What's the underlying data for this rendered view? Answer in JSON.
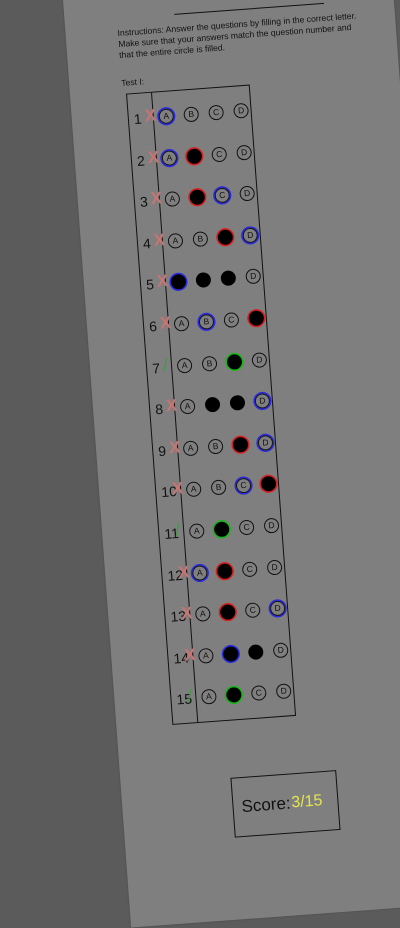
{
  "instructions": "Instructions:  Answer the questions by filling in the correct letter. Make sure that your answers match the question number and that the entire circle is filled.",
  "test_label": "Test I:",
  "choices": [
    "A",
    "B",
    "C",
    "D"
  ],
  "questions": [
    {
      "number": "1",
      "mark": "X",
      "status": "wrong",
      "filled": [],
      "key": 0,
      "key_color": "blue"
    },
    {
      "number": "2",
      "mark": "X",
      "status": "wrong",
      "filled": [
        1
      ],
      "key": 0,
      "key_color": "blue",
      "wrong_pick": 1
    },
    {
      "number": "3",
      "mark": "X",
      "status": "wrong",
      "filled": [
        1
      ],
      "key": 2,
      "key_color": "blue",
      "wrong_pick": 1
    },
    {
      "number": "4",
      "mark": "X",
      "status": "wrong",
      "filled": [
        2
      ],
      "key": 3,
      "key_color": "blue",
      "wrong_pick": 2
    },
    {
      "number": "5",
      "mark": "X",
      "status": "wrong",
      "filled": [
        0,
        1,
        2
      ],
      "key": 0,
      "key_color": "blue"
    },
    {
      "number": "6",
      "mark": "X",
      "status": "wrong",
      "filled": [
        3
      ],
      "key": 1,
      "key_color": "blue",
      "wrong_pick": 3
    },
    {
      "number": "7",
      "mark": "/",
      "status": "right",
      "filled": [
        2
      ],
      "key": 2,
      "key_color": "green"
    },
    {
      "number": "8",
      "mark": "X",
      "status": "wrong",
      "filled": [
        1,
        2
      ],
      "key": 3,
      "key_color": "blue"
    },
    {
      "number": "9",
      "mark": "X",
      "status": "wrong",
      "filled": [
        2
      ],
      "key": 3,
      "key_color": "blue",
      "wrong_pick": 2
    },
    {
      "number": "10",
      "mark": "X",
      "status": "wrong",
      "filled": [
        3
      ],
      "key": 2,
      "key_color": "blue",
      "wrong_pick": 3
    },
    {
      "number": "11",
      "mark": "/",
      "status": "right",
      "filled": [
        1
      ],
      "key": 1,
      "key_color": "green"
    },
    {
      "number": "12",
      "mark": "X",
      "status": "wrong",
      "filled": [
        1
      ],
      "key": 0,
      "key_color": "blue",
      "wrong_pick": 1
    },
    {
      "number": "13",
      "mark": "X",
      "status": "wrong",
      "filled": [
        1
      ],
      "key": 3,
      "key_color": "blue",
      "wrong_pick": 1
    },
    {
      "number": "14",
      "mark": "X",
      "status": "wrong",
      "filled": [
        1,
        2
      ],
      "key": 1,
      "key_color": "blue"
    },
    {
      "number": "15",
      "mark": "/",
      "status": "right",
      "filled": [
        1
      ],
      "key": 1,
      "key_color": "green"
    }
  ],
  "score": {
    "label": "Score:",
    "value": "3/15"
  },
  "colors": {
    "background": "#5b5b5b",
    "paper": "#7f7f7f",
    "wrong_mark": "#c77474",
    "right_mark": "#3f9b3f",
    "ring_blue": "#2a2ae0",
    "ring_red": "#d42020",
    "ring_green": "#14b814",
    "score_value": "#e6e64c"
  }
}
